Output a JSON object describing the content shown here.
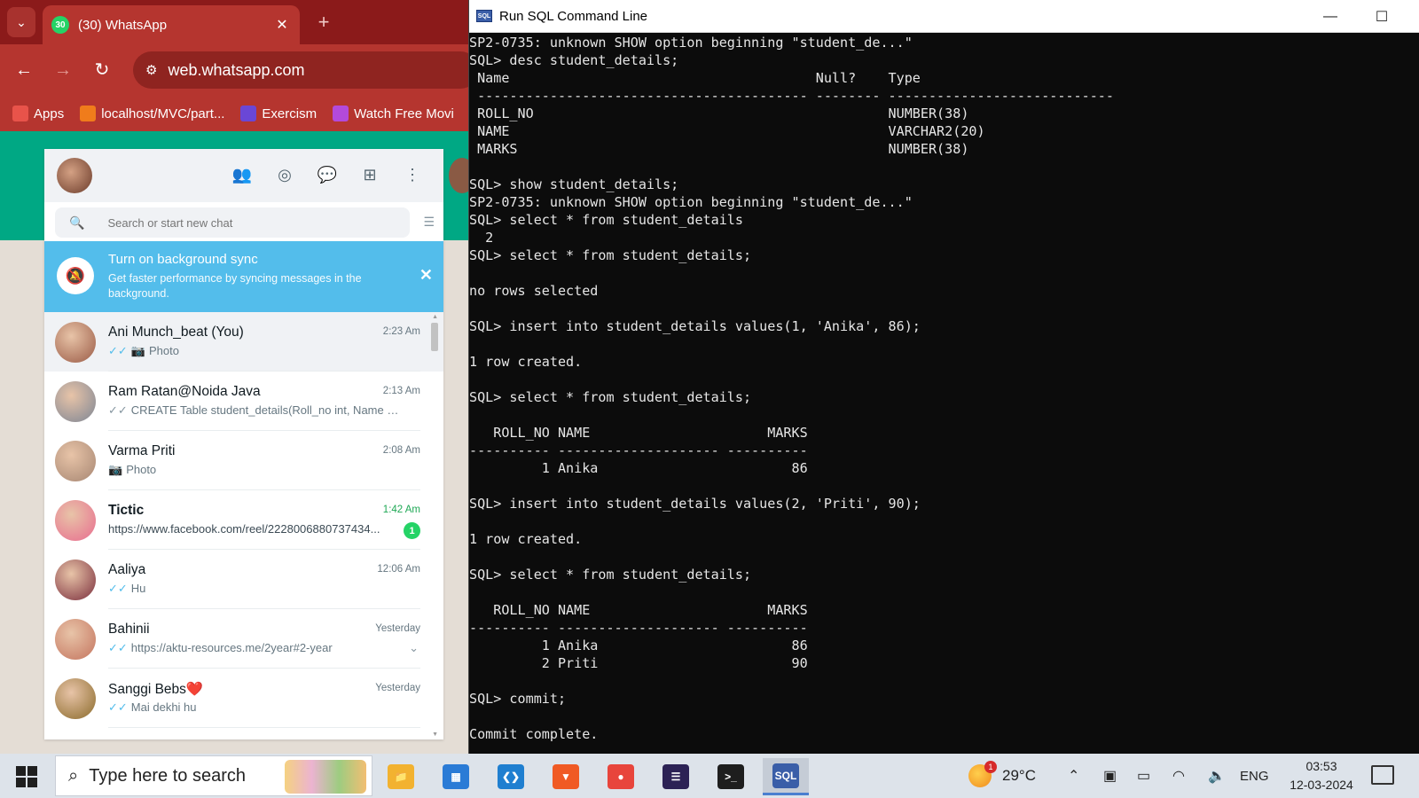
{
  "browser": {
    "tab_title": "(30) WhatsApp",
    "tab_badge": "30",
    "url": "web.whatsapp.com",
    "bookmarks": [
      {
        "label": "Apps",
        "icon": "apps-grid-icon",
        "color": "#e8534a"
      },
      {
        "label": "localhost/MVC/part...",
        "icon": "xampp-icon",
        "color": "#f07c1b"
      },
      {
        "label": "Exercism",
        "icon": "exercism-icon",
        "color": "#6a47d6"
      },
      {
        "label": "Watch Free Movi",
        "icon": "movies-icon",
        "color": "#b34adb"
      }
    ]
  },
  "whatsapp": {
    "search_placeholder": "Search or start new chat",
    "sync_banner": {
      "title": "Turn on background sync",
      "subtitle": "Get faster performance by syncing messages in the background."
    },
    "chats": [
      {
        "name": "Ani Munch_beat (You)",
        "time": "2:23 Am",
        "prefix_tick": "blue",
        "camera": true,
        "message": "Photo",
        "selected": true,
        "avatar": "#9a5a45"
      },
      {
        "name": "Ram Ratan@Noida Java",
        "time": "2:13 Am",
        "prefix_tick": "grey",
        "camera": false,
        "message": "CREATE Table student_details(Roll_no int, Name varcha...",
        "avatar": "#7d8594"
      },
      {
        "name": "Varma Priti",
        "time": "2:08 Am",
        "prefix_tick": "",
        "camera": true,
        "message": "Photo",
        "avatar": "#a68672"
      },
      {
        "name": "Tictic",
        "time": "1:42 Am",
        "prefix_tick": "",
        "camera": false,
        "message": "https://www.facebook.com/reel/2228006880737434...",
        "unread": "1",
        "bold": true,
        "avatar": "#e86c8f"
      },
      {
        "name": "Aaliya",
        "time": "12:06 Am",
        "prefix_tick": "blue",
        "camera": false,
        "message": "Hu",
        "avatar": "#7a2d3c"
      },
      {
        "name": "Bahinii",
        "time": "Yesterday",
        "prefix_tick": "blue",
        "camera": false,
        "message": "https://aktu-resources.me/2year#2-year",
        "chevron": true,
        "avatar": "#c4745e"
      },
      {
        "name": "Sanggi Bebs❤️",
        "time": "Yesterday",
        "prefix_tick": "blue",
        "camera": false,
        "message": "Mai dekhi hu",
        "avatar": "#8a6a2a"
      }
    ]
  },
  "sql_window": {
    "title": "Run SQL Command Line",
    "lines": [
      "SP2-0735: unknown SHOW option beginning \"student_de...\"",
      "SQL> desc student_details;",
      " Name                                      Null?    Type",
      " ----------------------------------------- -------- ----------------------------",
      " ROLL_NO                                            NUMBER(38)",
      " NAME                                               VARCHAR2(20)",
      " MARKS                                              NUMBER(38)",
      "",
      "SQL> show student_details;",
      "SP2-0735: unknown SHOW option beginning \"student_de...\"",
      "SQL> select * from student_details",
      "  2",
      "SQL> select * from student_details;",
      "",
      "no rows selected",
      "",
      "SQL> insert into student_details values(1, 'Anika', 86);",
      "",
      "1 row created.",
      "",
      "SQL> select * from student_details;",
      "",
      "   ROLL_NO NAME                      MARKS",
      "---------- -------------------- ----------",
      "         1 Anika                        86",
      "",
      "SQL> insert into student_details values(2, 'Priti', 90);",
      "",
      "1 row created.",
      "",
      "SQL> select * from student_details;",
      "",
      "   ROLL_NO NAME                      MARKS",
      "---------- -------------------- ----------",
      "         1 Anika                        86",
      "         2 Priti                        90",
      "",
      "SQL> commit;",
      "",
      "Commit complete."
    ]
  },
  "taskbar": {
    "search_placeholder": "Type here to search",
    "apps": [
      {
        "name": "file-explorer",
        "color": "#f2b230",
        "label": "📁"
      },
      {
        "name": "microsoft-store",
        "color": "#2a7bd6",
        "label": "▦"
      },
      {
        "name": "vscode",
        "color": "#1f7fd0",
        "label": "❮❯"
      },
      {
        "name": "brave",
        "color": "#f05a24",
        "label": "▼"
      },
      {
        "name": "chrome",
        "color": "#e8453c",
        "label": "●"
      },
      {
        "name": "eclipse",
        "color": "#2c2255",
        "label": "☰"
      },
      {
        "name": "terminal",
        "color": "#1e1e1e",
        "label": ">_"
      },
      {
        "name": "sql-command-line",
        "color": "#3a5ea8",
        "label": "SQL"
      }
    ],
    "weather": {
      "temp": "29°C",
      "badge": "1"
    },
    "lang": "ENG",
    "time": "03:53",
    "date": "12-03-2024"
  }
}
